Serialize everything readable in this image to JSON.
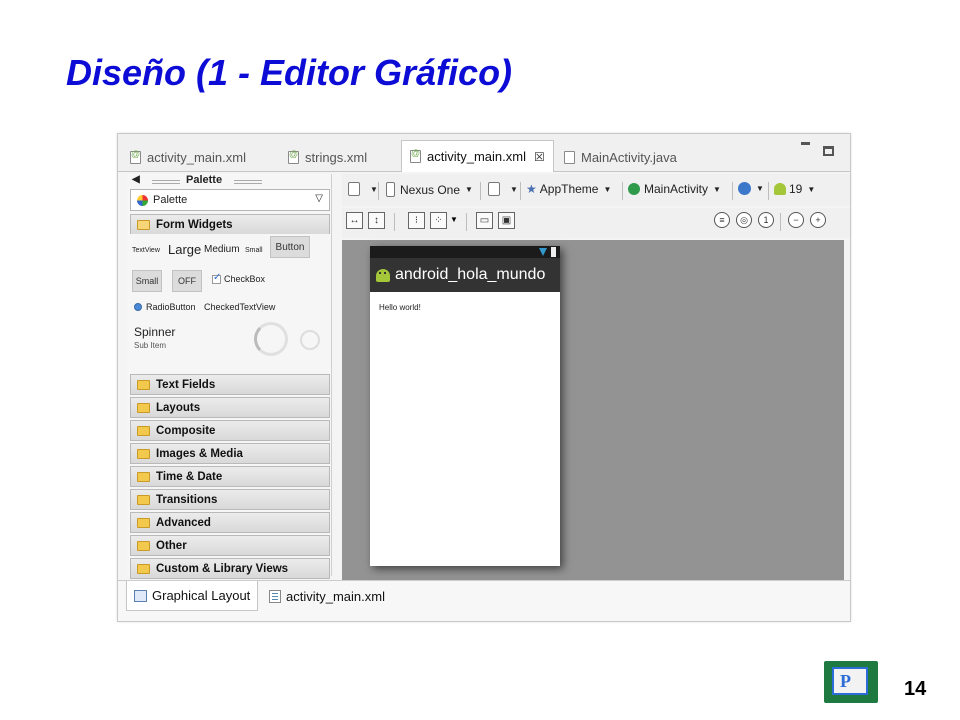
{
  "slide": {
    "title": "Diseño (1 - Editor Gráfico)",
    "page_number": "14"
  },
  "editor_tabs": [
    {
      "label": "activity_main.xml",
      "active": false
    },
    {
      "label": "strings.xml",
      "active": false
    },
    {
      "label": "activity_main.xml",
      "active": true,
      "close": "☒"
    },
    {
      "label": "MainActivity.java",
      "active": false
    }
  ],
  "palette": {
    "header": "Palette",
    "selector": "Palette",
    "form_widgets": "Form Widgets",
    "widgets": {
      "textview": "TextView",
      "large": "Large",
      "medium": "Medium",
      "small_text": "Small",
      "button": "Button",
      "small_button": "Small",
      "toggle": "OFF",
      "checkbox": "CheckBox",
      "radiobutton": "RadioButton",
      "checkedtextview": "CheckedTextView",
      "spinner": "Spinner",
      "sub_item": "Sub Item"
    },
    "categories": [
      "Text Fields",
      "Layouts",
      "Composite",
      "Images & Media",
      "Time & Date",
      "Transitions",
      "Advanced",
      "Other",
      "Custom & Library Views"
    ]
  },
  "toolbar": {
    "device": "Nexus One",
    "theme": "AppTheme",
    "activity": "MainActivity",
    "api": "19"
  },
  "preview": {
    "app_name": "android_hola_mundo",
    "hello_text": "Hello world!"
  },
  "bottom_tabs": [
    {
      "label": "Graphical Layout",
      "active": true
    },
    {
      "label": "activity_main.xml",
      "active": false
    }
  ],
  "colors": {
    "title": "#0c0cd6",
    "canvas": "#939393",
    "action_bar": "#333333",
    "android_green": "#a4c639"
  }
}
